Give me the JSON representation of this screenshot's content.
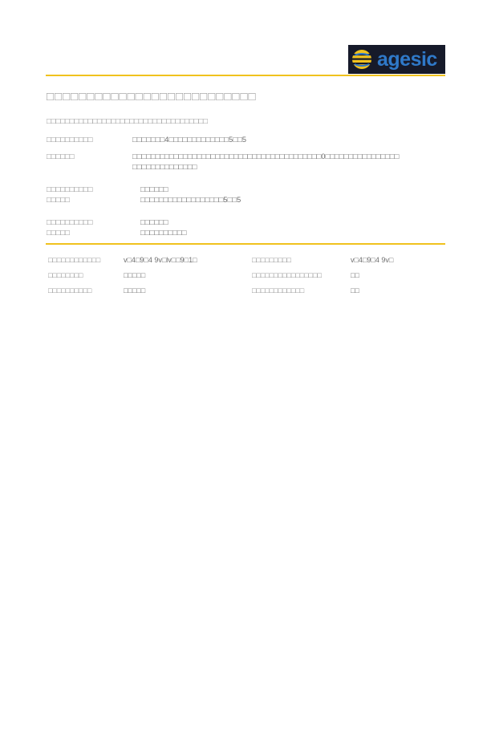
{
  "header": {
    "logo_text": "agesic",
    "colors": {
      "logo_background": "#161a2a",
      "logo_text": "#2f79c9",
      "logo_mark": "#f0c21e",
      "rule": "#f0c21e"
    }
  },
  "document": {
    "title": "□□□□□□□□□□□□□□□□□□□□□□□□□□",
    "subtitle": "□□□□□□□□□□□□□□□□□□□□□□□□□□□□□□□□□□□",
    "fields": [
      {
        "label": "□□□□□□□□□□",
        "value": "□□□□□□□4□□□□□□□□□□□□□5□□5"
      },
      {
        "label": "□□□□□□",
        "value": "□□□□□□□□□□□□□□□□□□□□□□□□□□□□□□□□□□□□□□□□□0□□□□□□□□□□□□□□□□ □□□□□□□□□□□□□□"
      },
      {
        "label_lines": [
          "□□□□□□□□□□",
          "□□□□□"
        ],
        "value": "□□□□□□"
      },
      {
        "label_lines": [],
        "value": "□□□□□□□□□□□□□□□□□□5□□5"
      },
      {
        "label_lines": [
          "□□□□□□□□□□",
          "□□□□□"
        ],
        "value": "□□□□□□"
      },
      {
        "label_lines": [],
        "value": "□□□□□□□□□□"
      }
    ]
  },
  "meta": {
    "rows": [
      {
        "left_label": "□□□□□□□□□□□□",
        "left_value": "v□4□9□4 9v□lv□□9□1□",
        "right_label": "□□□□□□□□□",
        "right_value": "v□4□9□4 9v□"
      },
      {
        "left_label": "□□□□□□□□",
        "left_value": "□□□□□",
        "right_label": "□□□□□□□□□□□□□□□□",
        "right_value": "□□"
      },
      {
        "left_label": "□□□□□□□□□□",
        "left_value": "□□□□□",
        "right_label": "□□□□□□□□□□□□",
        "right_value": "□□"
      }
    ]
  }
}
